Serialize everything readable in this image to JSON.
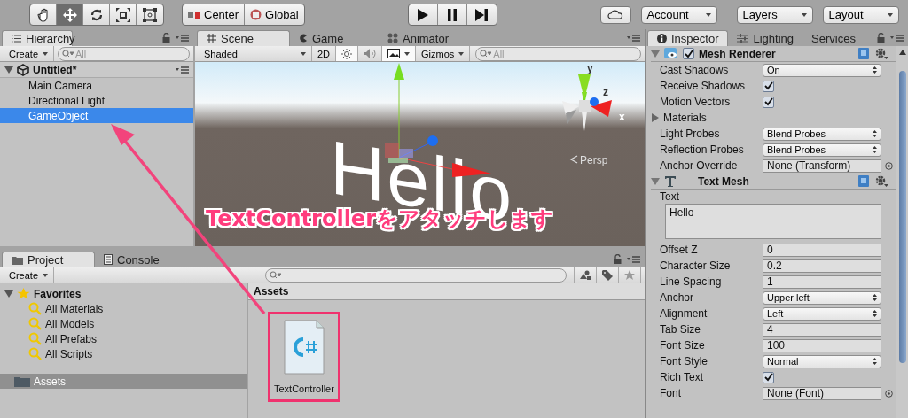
{
  "toolbar": {
    "tools": [
      {
        "kind": "hand",
        "selected": false
      },
      {
        "kind": "move",
        "selected": true
      },
      {
        "kind": "rotate",
        "selected": false
      },
      {
        "kind": "scale",
        "selected": false
      },
      {
        "kind": "rect",
        "selected": false
      }
    ],
    "pivot_buttons": [
      {
        "kind": "pivot",
        "label": "Center"
      },
      {
        "kind": "space",
        "label": "Global"
      }
    ],
    "account": "Account",
    "layers": "Layers",
    "layout": "Layout"
  },
  "hierarchy": {
    "tab": "Hierarchy",
    "create": "Create",
    "search_placeholder": "All",
    "scene": {
      "label": "Untitled*",
      "expanded": true
    },
    "items": [
      {
        "label": "Main Camera",
        "selected": false
      },
      {
        "label": "Directional Light",
        "selected": false
      },
      {
        "label": "GameObject",
        "selected": true
      }
    ]
  },
  "scene_view": {
    "tabs": [
      {
        "kind": "scene",
        "label": "Scene",
        "selected": true
      },
      {
        "kind": "game",
        "label": "Game",
        "selected": false
      },
      {
        "kind": "animator",
        "label": "Animator",
        "selected": false
      }
    ],
    "shading": "Shaded",
    "mode_2d": "2D",
    "scene_toggles": [
      {
        "on": true
      },
      {
        "on": false
      },
      {
        "on": true
      }
    ],
    "gizmos": "Gizmos",
    "search_placeholder": "All",
    "text_object": "Hello",
    "axis_labels": [
      "y",
      "z",
      "x"
    ],
    "projection": "Persp"
  },
  "annotation": {
    "caption": "TextControllerをアタッチします"
  },
  "project": {
    "tabs": [
      {
        "kind": "project",
        "label": "Project",
        "selected": true
      },
      {
        "kind": "console",
        "label": "Console",
        "selected": false
      }
    ],
    "create": "Create",
    "favorites": {
      "label": "Favorites",
      "expanded": true,
      "items": [
        "All Materials",
        "All Models",
        "All Prefabs",
        "All Scripts"
      ]
    },
    "folders": [
      {
        "label": "Assets",
        "selected": true
      }
    ],
    "breadcrumb": "Assets",
    "assets": [
      {
        "name": "TextController",
        "highlighted": true
      }
    ]
  },
  "inspector": {
    "tabs": [
      {
        "kind": "inspector",
        "label": "Inspector",
        "selected": true
      },
      {
        "kind": "lighting",
        "label": "Lighting",
        "selected": false
      },
      {
        "kind": "services",
        "label": "Services",
        "selected": false
      }
    ],
    "components": [
      {
        "name": "Mesh Renderer",
        "kind": "renderer",
        "enabled": true,
        "expanded": true,
        "properties": [
          {
            "kind": "dropdown",
            "label": "Cast Shadows",
            "value": "On"
          },
          {
            "kind": "checkbox",
            "label": "Receive Shadows",
            "checked": true
          },
          {
            "kind": "checkbox",
            "label": "Motion Vectors",
            "checked": true
          },
          {
            "kind": "foldout",
            "label": "Materials",
            "expanded": false
          },
          {
            "kind": "dropdown",
            "label": "Light Probes",
            "value": "Blend Probes"
          },
          {
            "kind": "dropdown",
            "label": "Reflection Probes",
            "value": "Blend Probes"
          },
          {
            "kind": "object",
            "label": "Anchor Override",
            "value": "None (Transform)"
          }
        ]
      },
      {
        "name": "Text Mesh",
        "kind": "text",
        "expanded": true,
        "properties": [
          {
            "kind": "textarea",
            "label": "Text",
            "value": "Hello"
          },
          {
            "kind": "field",
            "label": "Offset Z",
            "value": "0"
          },
          {
            "kind": "field",
            "label": "Character Size",
            "value": "0.2"
          },
          {
            "kind": "field",
            "label": "Line Spacing",
            "value": "1"
          },
          {
            "kind": "dropdown",
            "label": "Anchor",
            "value": "Upper left"
          },
          {
            "kind": "dropdown",
            "label": "Alignment",
            "value": "Left"
          },
          {
            "kind": "field",
            "label": "Tab Size",
            "value": "4"
          },
          {
            "kind": "field",
            "label": "Font Size",
            "value": "100"
          },
          {
            "kind": "dropdown",
            "label": "Font Style",
            "value": "Normal"
          },
          {
            "kind": "checkbox",
            "label": "Rich Text",
            "checked": true
          },
          {
            "kind": "object",
            "label": "Font",
            "value": "None (Font)"
          }
        ]
      }
    ]
  }
}
